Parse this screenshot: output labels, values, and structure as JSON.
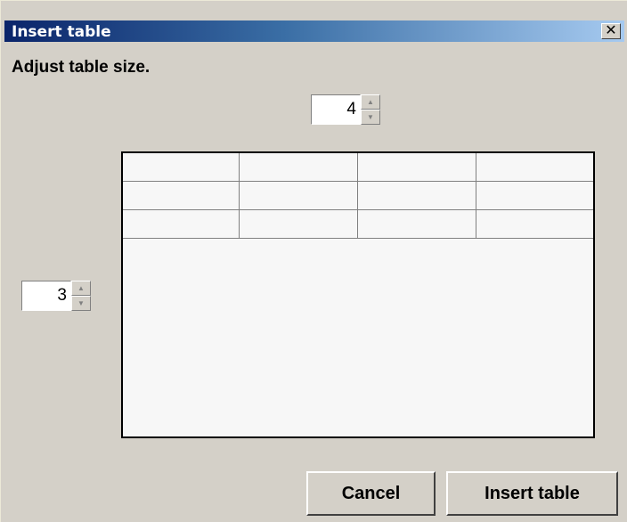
{
  "dialog": {
    "title": "Insert table",
    "close_symbol": "✕",
    "instruction": "Adjust table size."
  },
  "columns_spinner": {
    "value": "4"
  },
  "rows_spinner": {
    "value": "3"
  },
  "preview": {
    "rows": 3,
    "columns": 4
  },
  "buttons": {
    "cancel": "Cancel",
    "insert": "Insert table"
  },
  "colors": {
    "titlebar_start": "#0a246a",
    "titlebar_end": "#a6caf0",
    "dialog_bg": "#d4d0c8"
  }
}
